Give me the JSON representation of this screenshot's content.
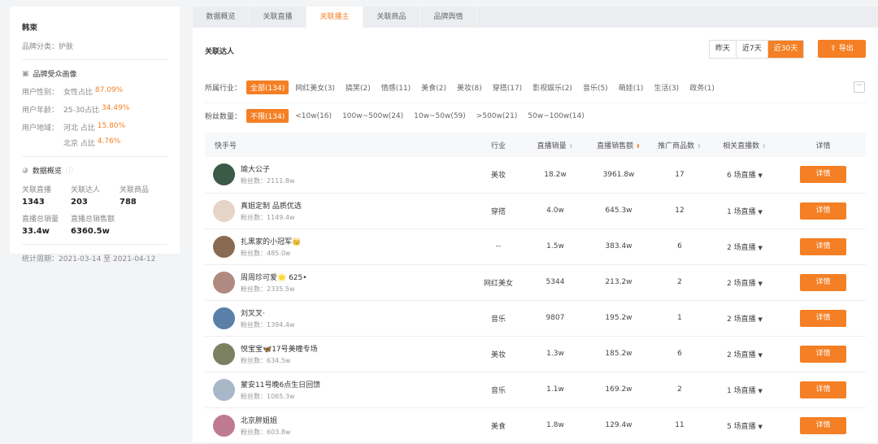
{
  "left": {
    "brand": "韩束",
    "category_label": "品牌分类：",
    "category": "护肤",
    "audience_title": "品牌受众画像",
    "gender_label": "用户性别：",
    "gender_text": "女性占比",
    "gender_value": "87.09%",
    "age_label": "用户年龄：",
    "age_text": "25-30占比",
    "age_value": "34.49%",
    "region_label": "用户地域：",
    "region1_text": "河北 占比",
    "region1_value": "15.80%",
    "region2_text": "北京 占比",
    "region2_value": "4.76%",
    "overview_title": "数据概览",
    "stats": [
      {
        "label": "关联直播",
        "value": "1343"
      },
      {
        "label": "关联达人",
        "value": "203"
      },
      {
        "label": "关联商品",
        "value": "788"
      },
      {
        "label": "直播总销量",
        "value": "33.4w"
      },
      {
        "label": "直播总销售额",
        "value": "6360.5w"
      }
    ],
    "period_label": "统计周期：",
    "period": "2021-03-14 至 2021-04-12"
  },
  "tabs": [
    "数据概览",
    "关联直播",
    "关联播主",
    "关联商品",
    "品牌舆情"
  ],
  "section_title": "关联达人",
  "ranges": [
    "昨天",
    "近7天",
    "近30天"
  ],
  "export_label": "导出",
  "industry": {
    "label": "所属行业：",
    "options": [
      "全部(134)",
      "网红美女(3)",
      "搞笑(2)",
      "情感(11)",
      "美食(2)",
      "美妆(8)",
      "穿搭(17)",
      "影视娱乐(2)",
      "音乐(5)",
      "萌娃(1)",
      "生活(3)",
      "政务(1)"
    ]
  },
  "fans": {
    "label": "粉丝数量：",
    "options": [
      "不限(134)",
      "<10w(16)",
      "100w~500w(24)",
      "10w~50w(59)",
      ">500w(21)",
      "50w~100w(14)"
    ]
  },
  "columns": [
    "快手号",
    "行业",
    "直播销量",
    "直播销售额",
    "推广商品数",
    "相关直播数",
    "详情"
  ],
  "fans_prefix": "粉丝数：",
  "detail_label": "详情",
  "rows": [
    {
      "name": "瑜大公子",
      "fans": "2111.8w",
      "industry": "美妆",
      "sales": "18.2w",
      "revenue": "3961.8w",
      "products": "17",
      "lives": "6 场直播",
      "color": "#3b5a48"
    },
    {
      "name": "真姐定制 品质优选",
      "fans": "1149.4w",
      "industry": "穿搭",
      "sales": "4.0w",
      "revenue": "645.3w",
      "products": "12",
      "lives": "1 场直播",
      "color": "#e6d4c8"
    },
    {
      "name": "扎黑家的小冠军👑",
      "fans": "485.0w",
      "industry": "--",
      "sales": "1.5w",
      "revenue": "383.4w",
      "products": "6",
      "lives": "2 场直播",
      "color": "#8a6a50"
    },
    {
      "name": "周周珍可爱🌟 625•",
      "fans": "2335.5w",
      "industry": "网红美女",
      "sales": "5344",
      "revenue": "213.2w",
      "products": "2",
      "lives": "2 场直播",
      "color": "#b08a80"
    },
    {
      "name": "刘叉叉·",
      "fans": "1394.4w",
      "industry": "音乐",
      "sales": "9807",
      "revenue": "195.2w",
      "products": "1",
      "lives": "2 场直播",
      "color": "#5a7fa8"
    },
    {
      "name": "悦宝宝🦋17号美瞳专场",
      "fans": "634.5w",
      "industry": "美妆",
      "sales": "1.3w",
      "revenue": "185.2w",
      "products": "6",
      "lives": "2 场直播",
      "color": "#7a8060"
    },
    {
      "name": "蒙安11号晚6点生日回馈",
      "fans": "1065.3w",
      "industry": "音乐",
      "sales": "1.1w",
      "revenue": "169.2w",
      "products": "2",
      "lives": "1 场直播",
      "color": "#a8b8c8"
    },
    {
      "name": "北京胖姐姐",
      "fans": "603.8w",
      "industry": "美食",
      "sales": "1.8w",
      "revenue": "129.4w",
      "products": "11",
      "lives": "5 场直播",
      "color": "#c07a90"
    }
  ]
}
